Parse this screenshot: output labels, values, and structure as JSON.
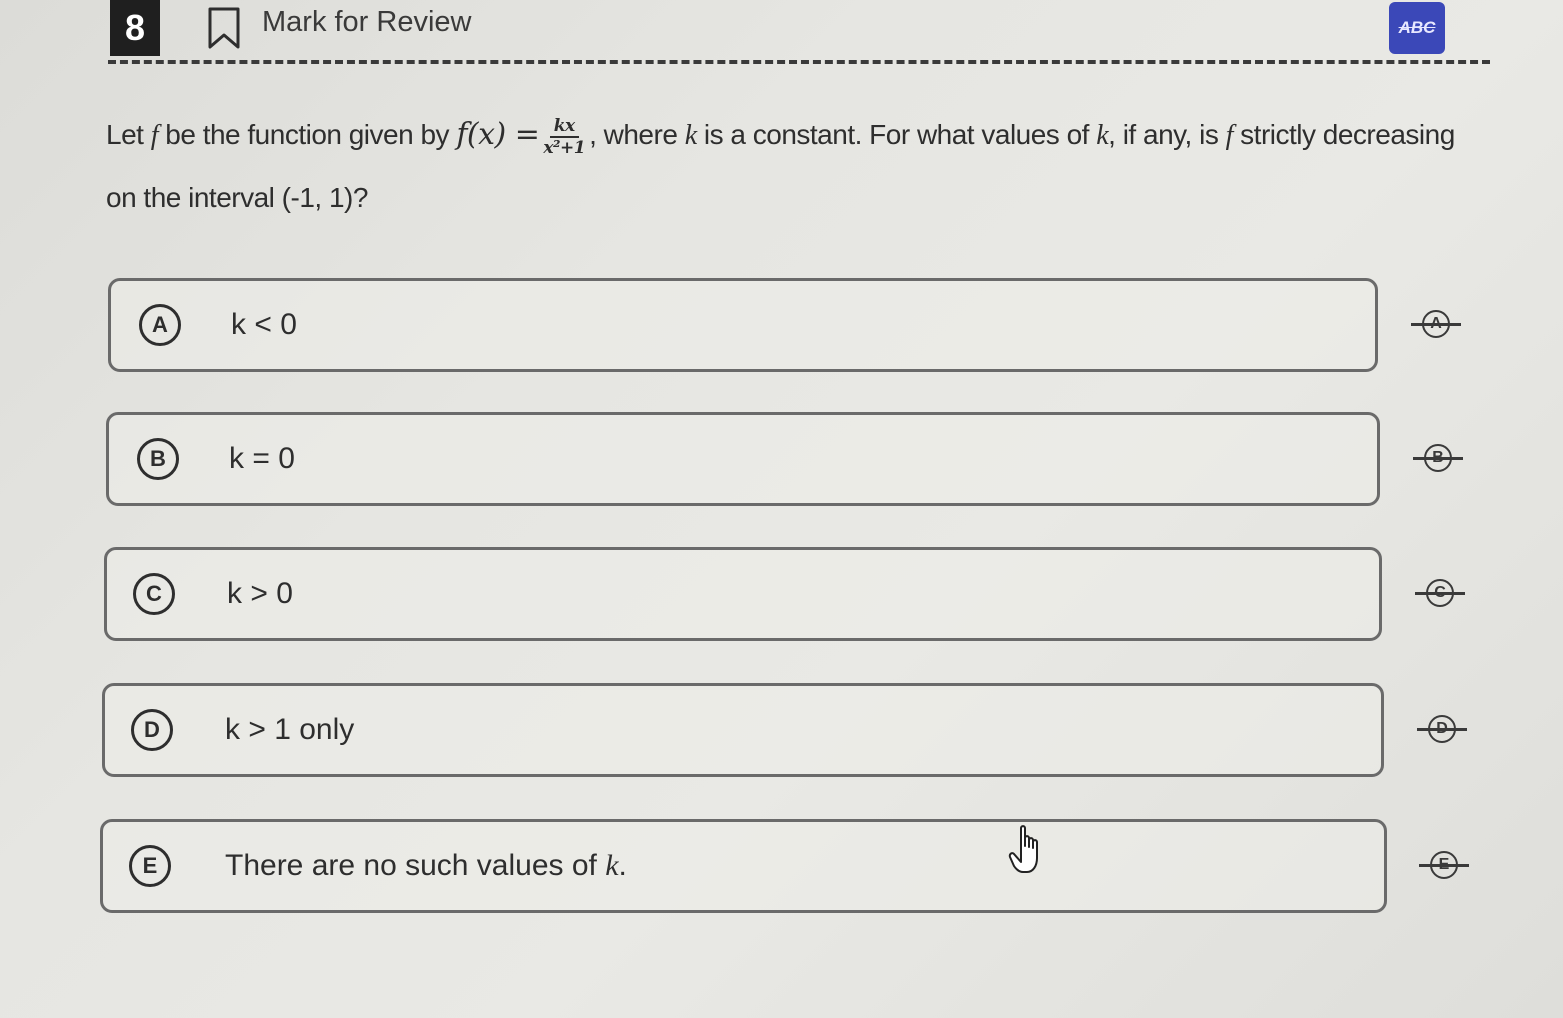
{
  "header": {
    "question_number": "8",
    "mark_label": "Mark for Review",
    "abc_label": "ABC"
  },
  "question": {
    "part1": "Let ",
    "f1": "f",
    "part2": " be the function given by ",
    "fx": "f(x) =",
    "frac_num": "kx",
    "frac_den": "x²+1",
    "part3": ", where ",
    "k1": "k",
    "part4": " is a constant. For what values of ",
    "k2": "k",
    "part5": ", if any, is ",
    "f2": "f",
    "part6": " strictly decreasing on the interval (-1, 1)?"
  },
  "options": [
    {
      "letter": "A",
      "text": "k < 0"
    },
    {
      "letter": "B",
      "text": "k = 0"
    },
    {
      "letter": "C",
      "text": "k > 0"
    },
    {
      "letter": "D",
      "text": "k > 1 only"
    },
    {
      "letter": "E",
      "text_main": "There are no such values of ",
      "text_var": "k",
      "text_end": "."
    }
  ],
  "colors": {
    "accent": "#3b48b8",
    "text": "#2e2e2e",
    "border": "#6a6a6a"
  }
}
